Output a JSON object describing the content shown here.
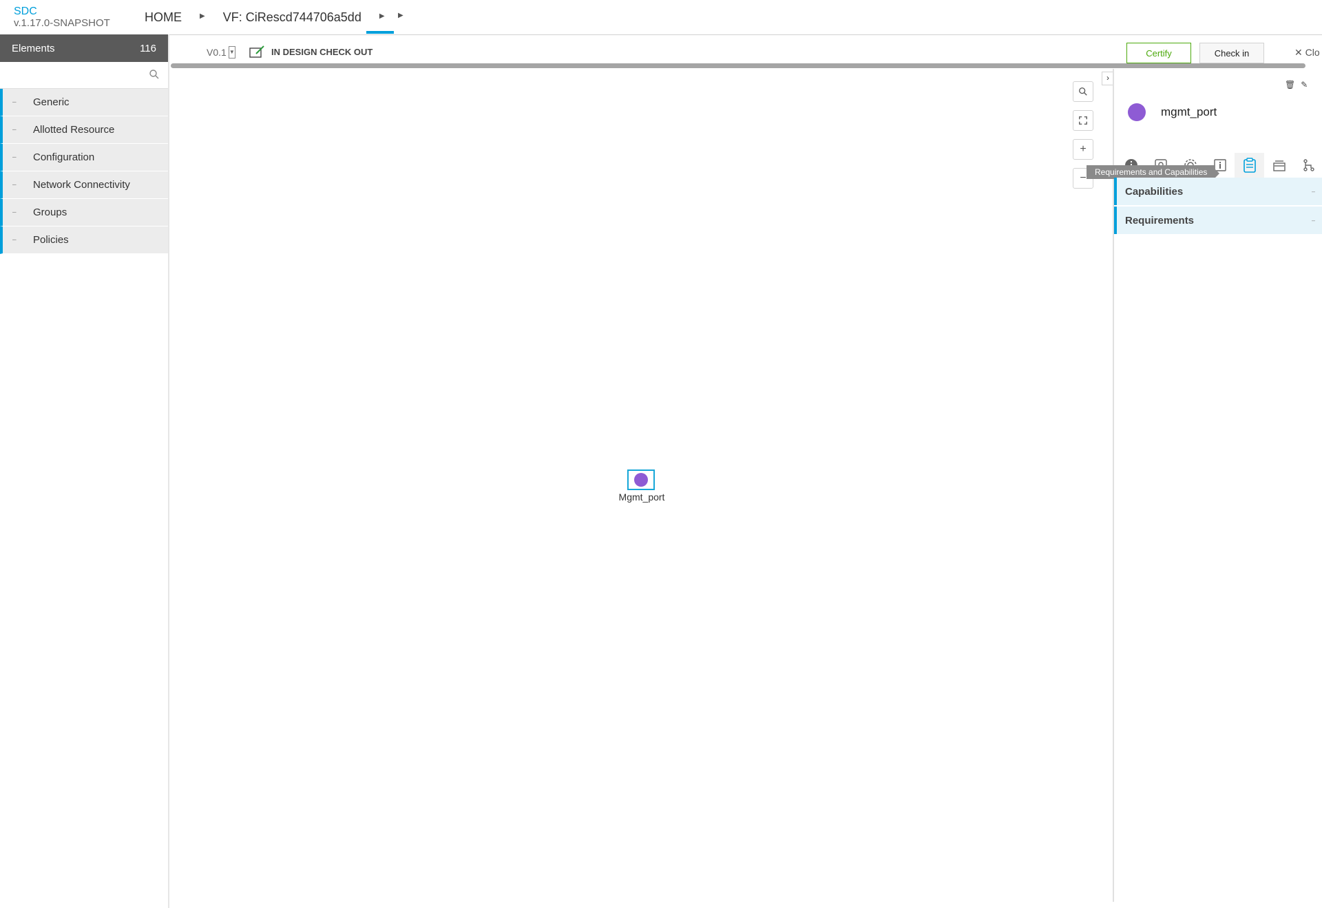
{
  "header": {
    "brand": "SDC",
    "version": "v.1.17.0-SNAPSHOT",
    "breadcrumb": {
      "home": "HOME",
      "vf": "VF: CiRescd744706a5dd"
    }
  },
  "palette": {
    "title": "Elements",
    "count": "116",
    "search_placeholder": "",
    "groups": [
      {
        "label": "Generic"
      },
      {
        "label": "Allotted Resource"
      },
      {
        "label": "Configuration"
      },
      {
        "label": "Network Connectivity"
      },
      {
        "label": "Groups"
      },
      {
        "label": "Policies"
      }
    ]
  },
  "toolbar": {
    "version": "V0.1",
    "status": "IN DESIGN CHECK OUT",
    "certify_label": "Certify",
    "checkin_label": "Check in",
    "close_label": "Clo"
  },
  "canvas": {
    "node_label": "Mgmt_port"
  },
  "details_panel": {
    "component_name": "mgmt_port",
    "tooltip": "Requirements and Capabilities",
    "sections": [
      {
        "label": "Capabilities"
      },
      {
        "label": "Requirements"
      }
    ]
  },
  "colors": {
    "accent": "#009fdb",
    "certify": "#4ca90c",
    "node": "#8e5bd4",
    "palette_header": "#5a5a5a"
  }
}
